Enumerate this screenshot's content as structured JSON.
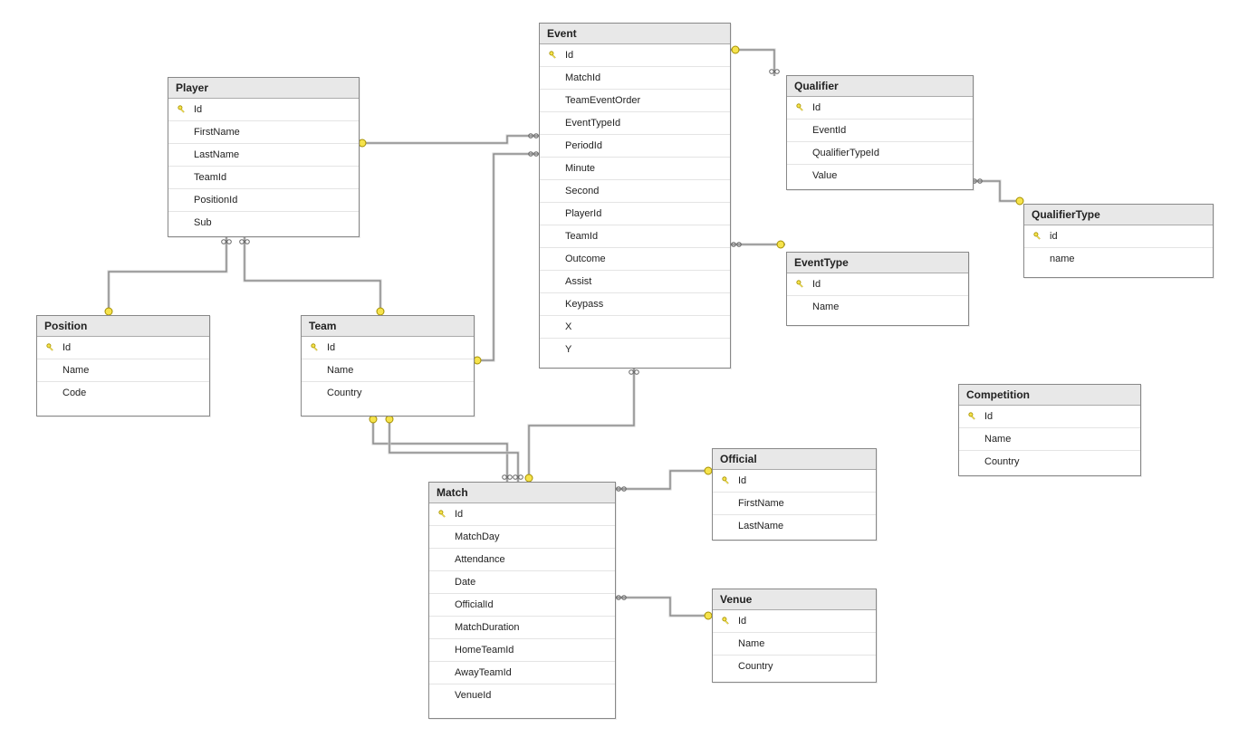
{
  "entities": {
    "player": {
      "title": "Player",
      "fields": [
        {
          "name": "Id",
          "pk": true
        },
        {
          "name": "FirstName",
          "pk": false
        },
        {
          "name": "LastName",
          "pk": false
        },
        {
          "name": "TeamId",
          "pk": false
        },
        {
          "name": "PositionId",
          "pk": false
        },
        {
          "name": "Sub",
          "pk": false
        }
      ]
    },
    "event": {
      "title": "Event",
      "fields": [
        {
          "name": "Id",
          "pk": true
        },
        {
          "name": "MatchId",
          "pk": false
        },
        {
          "name": "TeamEventOrder",
          "pk": false
        },
        {
          "name": "EventTypeId",
          "pk": false
        },
        {
          "name": "PeriodId",
          "pk": false
        },
        {
          "name": "Minute",
          "pk": false
        },
        {
          "name": "Second",
          "pk": false
        },
        {
          "name": "PlayerId",
          "pk": false
        },
        {
          "name": "TeamId",
          "pk": false
        },
        {
          "name": "Outcome",
          "pk": false
        },
        {
          "name": "Assist",
          "pk": false
        },
        {
          "name": "Keypass",
          "pk": false
        },
        {
          "name": "X",
          "pk": false
        },
        {
          "name": "Y",
          "pk": false
        }
      ]
    },
    "qualifier": {
      "title": "Qualifier",
      "fields": [
        {
          "name": "Id",
          "pk": true
        },
        {
          "name": "EventId",
          "pk": false
        },
        {
          "name": "QualifierTypeId",
          "pk": false
        },
        {
          "name": "Value",
          "pk": false
        }
      ]
    },
    "qualifierType": {
      "title": "QualifierType",
      "fields": [
        {
          "name": "id",
          "pk": true
        },
        {
          "name": "name",
          "pk": false
        }
      ]
    },
    "eventType": {
      "title": "EventType",
      "fields": [
        {
          "name": "Id",
          "pk": true
        },
        {
          "name": "Name",
          "pk": false
        }
      ]
    },
    "position": {
      "title": "Position",
      "fields": [
        {
          "name": "Id",
          "pk": true
        },
        {
          "name": "Name",
          "pk": false
        },
        {
          "name": "Code",
          "pk": false
        }
      ]
    },
    "team": {
      "title": "Team",
      "fields": [
        {
          "name": "Id",
          "pk": true
        },
        {
          "name": "Name",
          "pk": false
        },
        {
          "name": "Country",
          "pk": false
        }
      ]
    },
    "competition": {
      "title": "Competition",
      "fields": [
        {
          "name": "Id",
          "pk": true
        },
        {
          "name": "Name",
          "pk": false
        },
        {
          "name": "Country",
          "pk": false
        }
      ]
    },
    "match": {
      "title": "Match",
      "fields": [
        {
          "name": "Id",
          "pk": true
        },
        {
          "name": "MatchDay",
          "pk": false
        },
        {
          "name": "Attendance",
          "pk": false
        },
        {
          "name": "Date",
          "pk": false
        },
        {
          "name": "OfficialId",
          "pk": false
        },
        {
          "name": "MatchDuration",
          "pk": false
        },
        {
          "name": "HomeTeamId",
          "pk": false
        },
        {
          "name": "AwayTeamId",
          "pk": false
        },
        {
          "name": "VenueId",
          "pk": false
        }
      ]
    },
    "official": {
      "title": "Official",
      "fields": [
        {
          "name": "Id",
          "pk": true
        },
        {
          "name": "FirstName",
          "pk": false
        },
        {
          "name": "LastName",
          "pk": false
        }
      ]
    },
    "venue": {
      "title": "Venue",
      "fields": [
        {
          "name": "Id",
          "pk": true
        },
        {
          "name": "Name",
          "pk": false
        },
        {
          "name": "Country",
          "pk": false
        }
      ]
    }
  }
}
